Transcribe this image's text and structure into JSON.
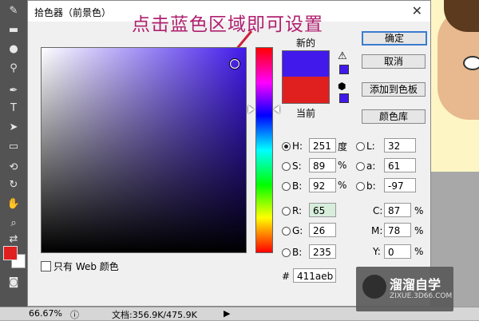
{
  "dialog": {
    "title": "拾色器（前景色）",
    "close_glyph": "✕",
    "annotation": "点击蓝色区域即可设置"
  },
  "swatches": {
    "new_label": "新的",
    "current_label": "当前",
    "new_color": "#411aeb",
    "current_color": "#e01f1f"
  },
  "buttons": {
    "ok": "确定",
    "cancel": "取消",
    "add_to_swatches": "添加到色板",
    "color_libraries": "颜色库"
  },
  "web_only_label": "只有 Web 颜色",
  "fields": {
    "H": {
      "label": "H:",
      "value": "251",
      "unit": "度"
    },
    "S": {
      "label": "S:",
      "value": "89",
      "unit": "%"
    },
    "B": {
      "label": "B:",
      "value": "92",
      "unit": "%"
    },
    "R": {
      "label": "R:",
      "value": "65"
    },
    "G": {
      "label": "G:",
      "value": "26"
    },
    "Bl": {
      "label": "B:",
      "value": "235"
    },
    "L": {
      "label": "L:",
      "value": "32"
    },
    "a": {
      "label": "a:",
      "value": "61"
    },
    "b": {
      "label": "b:",
      "value": "-97"
    },
    "C": {
      "label": "C:",
      "value": "87",
      "unit": "%"
    },
    "M": {
      "label": "M:",
      "value": "78",
      "unit": "%"
    },
    "Y": {
      "label": "Y:",
      "value": "0",
      "unit": "%"
    },
    "hex": {
      "label": "#",
      "value": "411aeb"
    }
  },
  "statusbar": {
    "zoom": "66.67%",
    "doc": "文档:356.9K/475.9K"
  },
  "watermark": {
    "text": "溜溜自学",
    "url": "ZIXUE.3D66.COM"
  },
  "colors": {
    "accent": "#3b7bd0",
    "annotation": "#b02070"
  }
}
